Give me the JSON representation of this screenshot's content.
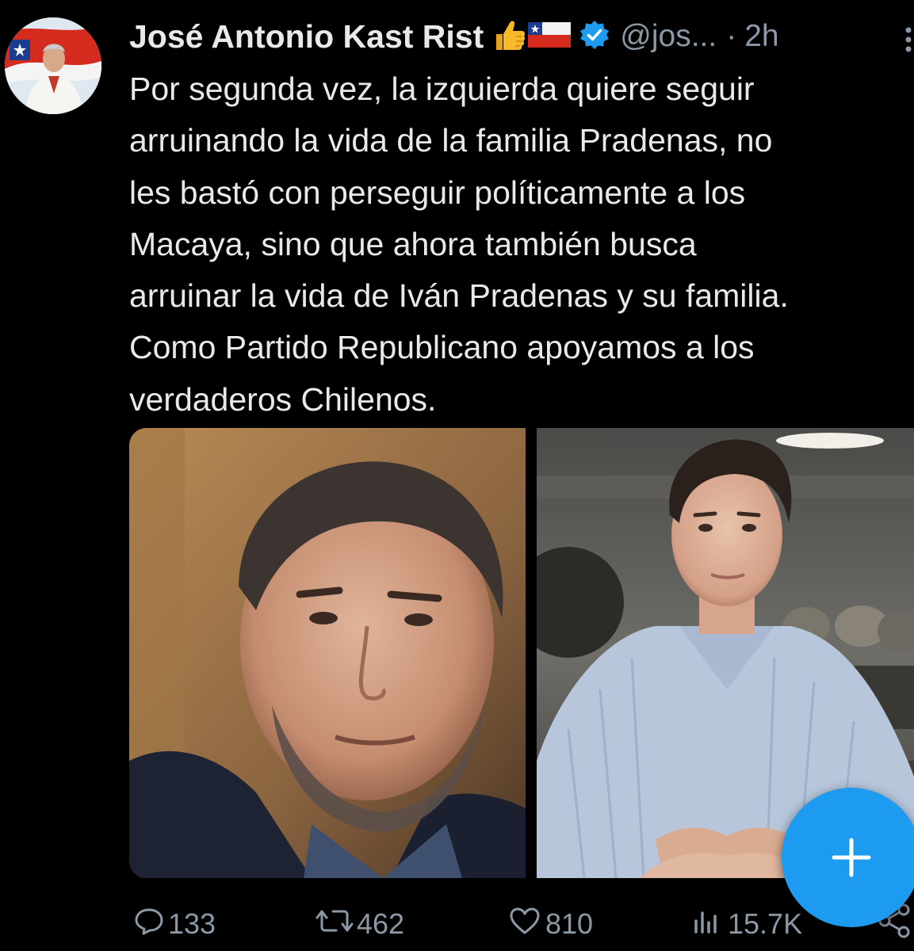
{
  "tweet": {
    "author_name": "José Antonio Kast Rist",
    "handle": "@jos...",
    "separator": "·",
    "time": "2h",
    "text_lines": [
      "Por segunda vez, la izquierda quiere seguir",
      "arruinando la vida de la familia Pradenas, no",
      "les bastó con perseguir políticamente a los",
      "Macaya, sino que ahora también busca",
      "arruinar la vida de Iván Pradenas y su familia.",
      "Como Partido Republicano apoyamos a los",
      "verdaderos Chilenos."
    ],
    "icons": {
      "emoji_1": "thumbs-up-emoji",
      "emoji_2": "chile-flag-emoji",
      "verified": "verified-badge-icon",
      "more": "more-options-icon"
    }
  },
  "media": {
    "count": 2
  },
  "actions": {
    "replies": "133",
    "reposts": "462",
    "likes": "810",
    "views": "15.7K"
  },
  "fab": {
    "label": "+",
    "icon": "plus-icon"
  },
  "colors": {
    "background": "#000000",
    "text_primary": "#e7e9ea",
    "text_secondary": "#8b98a5",
    "accent": "#1d9bf0"
  }
}
